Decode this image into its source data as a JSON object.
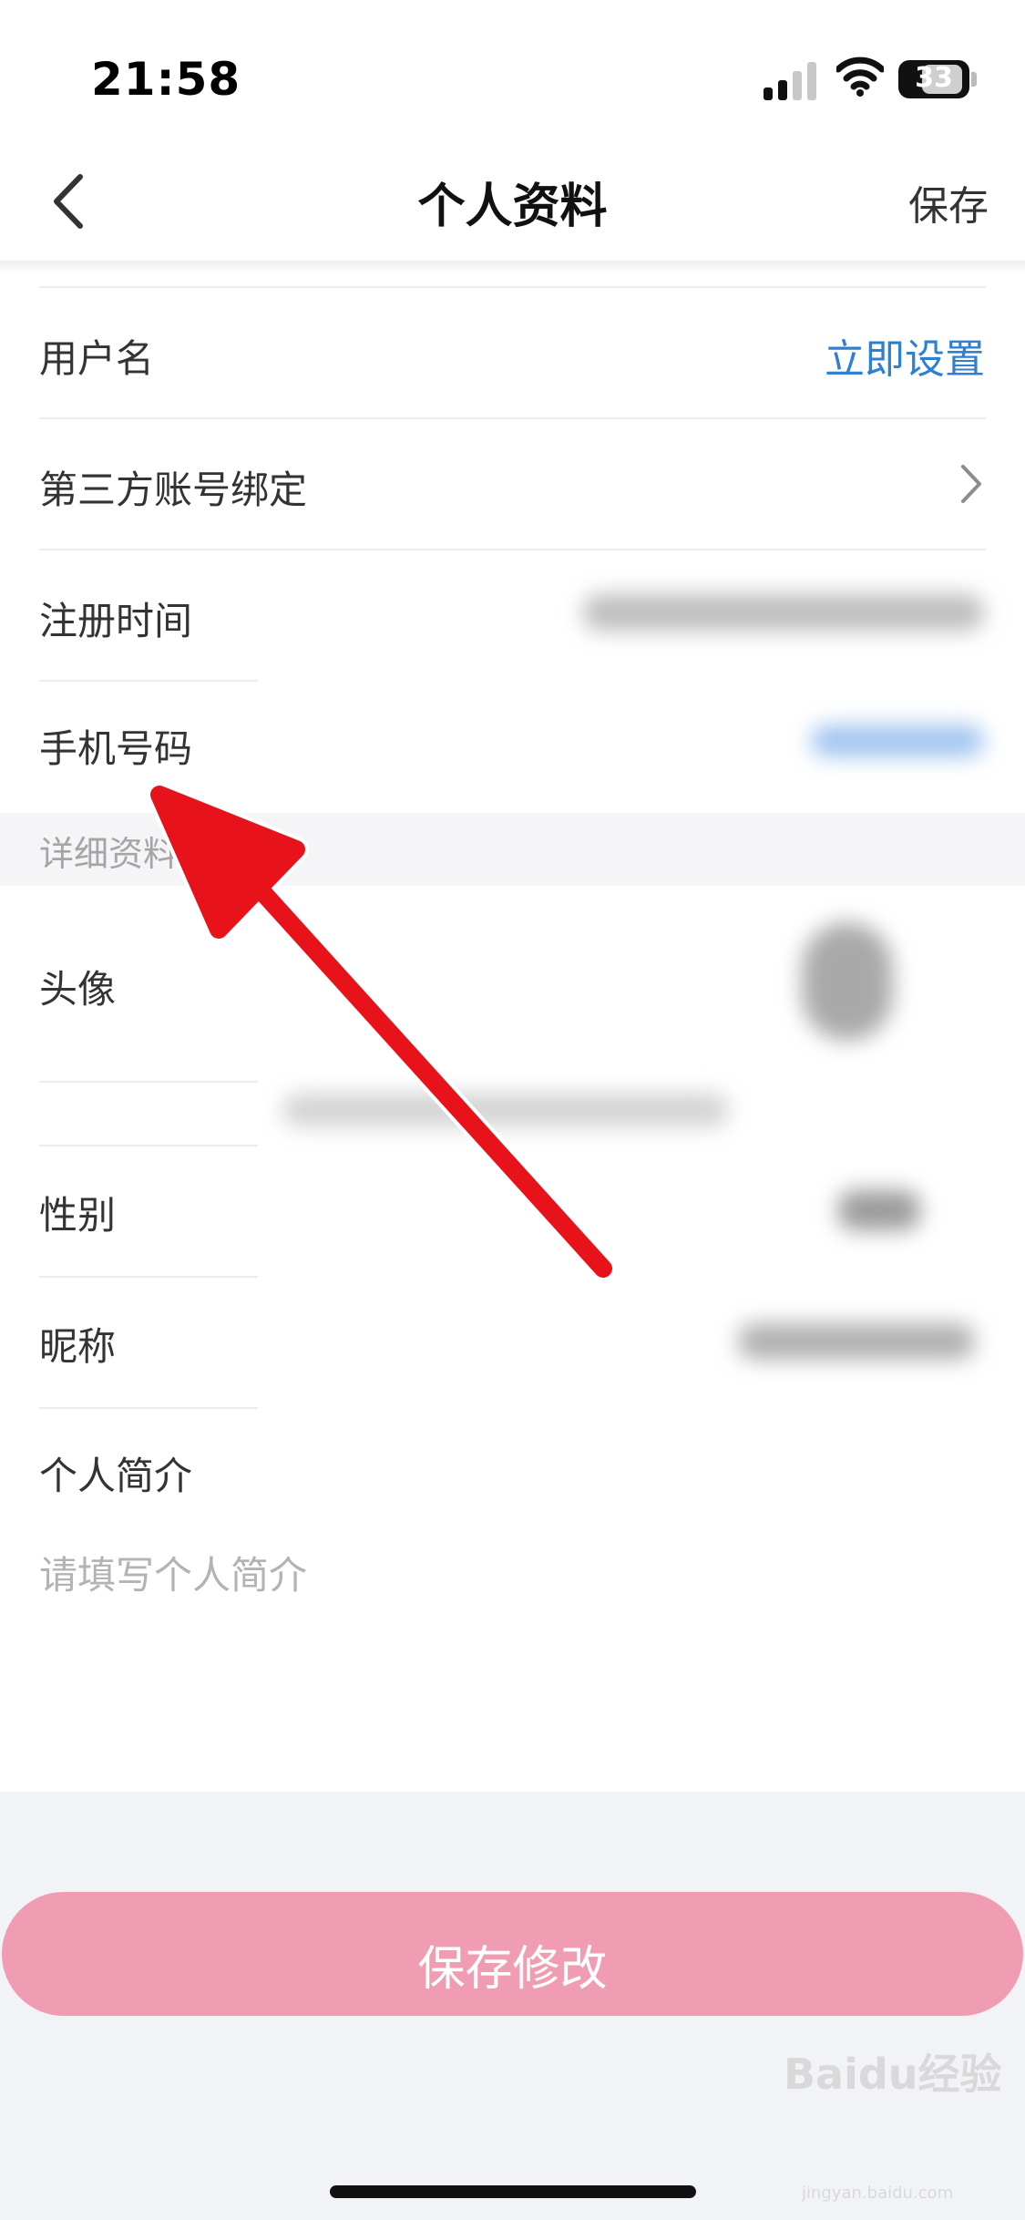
{
  "status_bar": {
    "time": "21:58",
    "battery": "33"
  },
  "nav": {
    "title": "个人资料",
    "save": "保存"
  },
  "account_rows": [
    {
      "label": "用户名",
      "value": "立即设置"
    },
    {
      "label": "第三方账号绑定"
    },
    {
      "label": "注册时间"
    },
    {
      "label": "手机号码"
    }
  ],
  "section": {
    "title": "详细资料"
  },
  "detail_rows": [
    {
      "label": "头像"
    },
    {
      "label": "性别"
    },
    {
      "label": "昵称"
    },
    {
      "label": "个人简介"
    }
  ],
  "bio": {
    "placeholder": "请填写个人简介"
  },
  "button": {
    "save_changes": "保存修改"
  },
  "watermark": {
    "text": "Baidu经验",
    "sub": "jingyan.baidu.com"
  },
  "colors": {
    "accent_blue": "#2f7fd3",
    "button_pink": "#f09db3",
    "arrow_red": "#e8121b"
  }
}
